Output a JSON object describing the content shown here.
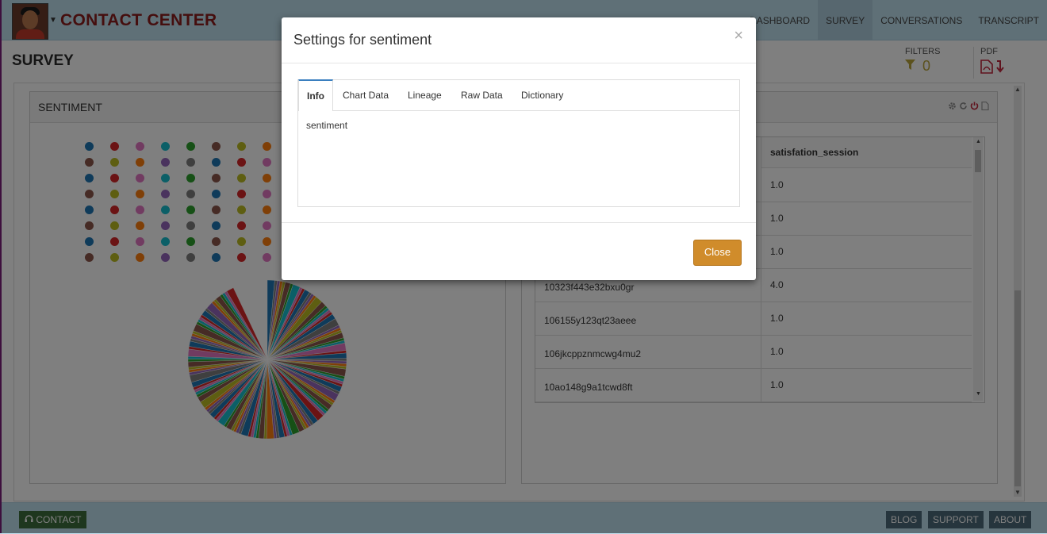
{
  "header": {
    "brand": "CONTACT CENTER",
    "nav": [
      "DASHBOARD",
      "SURVEY",
      "CONVERSATIONS",
      "TRANSCRIPT"
    ],
    "active_nav": "SURVEY"
  },
  "page": {
    "title": "SURVEY",
    "filters_label": "FILTERS",
    "filters_count": "0",
    "pdf_label": "PDF"
  },
  "panels": {
    "sentiment_title": "SENTIMENT"
  },
  "table": {
    "header_col2": "satisfation_session",
    "rows": [
      {
        "id": "",
        "value": "1.0"
      },
      {
        "id": "",
        "value": "1.0"
      },
      {
        "id": "",
        "value": "1.0"
      },
      {
        "id": "10323f443e32bxu0gr",
        "value": "4.0"
      },
      {
        "id": "106155y123qt23aeee",
        "value": "1.0"
      },
      {
        "id": "106jkcppznmcwg4mu2",
        "value": "1.0"
      },
      {
        "id": "10ao148g9a1tcwd8ft",
        "value": "1.0"
      }
    ]
  },
  "footer": {
    "contact": "CONTACT",
    "blog": "BLOG",
    "support": "SUPPORT",
    "about": "ABOUT"
  },
  "modal": {
    "title": "Settings for sentiment",
    "close_x": "×",
    "tabs": [
      "Info",
      "Chart Data",
      "Lineage",
      "Raw Data",
      "Dictionary"
    ],
    "active_tab": "Info",
    "info_text": "sentiment",
    "close_button": "Close"
  },
  "colors": {
    "brand": "#8a1c1c",
    "navbar_bg": "#bfe0ee",
    "close_button": "#d08c2b",
    "palette": [
      "#1f77b4",
      "#ff7f0e",
      "#2ca02c",
      "#d62728",
      "#9467bd",
      "#8c564b",
      "#e377c2",
      "#7f7f7f",
      "#bcbd22",
      "#17becf"
    ]
  },
  "icons": {
    "filter": "funnel-icon",
    "pdf": "file-pdf-icon",
    "download": "arrow-down-icon",
    "gear": "gear-icon",
    "refresh": "refresh-icon",
    "power": "power-icon",
    "file": "file-icon",
    "headset": "headset-icon"
  }
}
